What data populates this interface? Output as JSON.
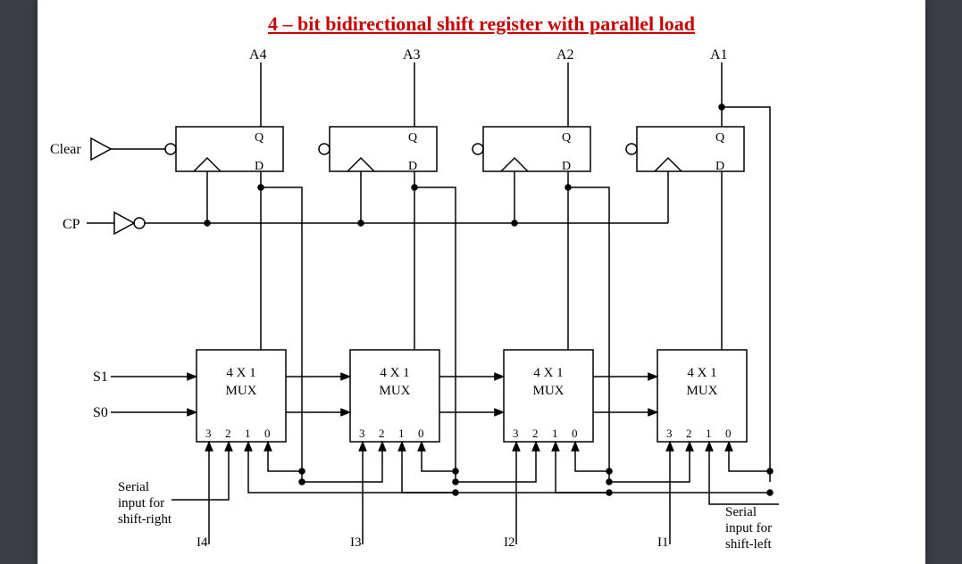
{
  "title": "4 – bit bidirectional shift register with parallel load",
  "outputs": {
    "A4": "A4",
    "A3": "A3",
    "A2": "A2",
    "A1": "A1"
  },
  "clear_label": "Clear",
  "cp_label": "CP",
  "ff": {
    "Q": "Q",
    "D": "D"
  },
  "mux": {
    "type": "4 X 1",
    "label": "MUX",
    "in3": "3",
    "in2": "2",
    "in1": "1",
    "in0": "0"
  },
  "select": {
    "S1": "S1",
    "S0": "S0"
  },
  "parallel_inputs": {
    "I4": "I4",
    "I3": "I3",
    "I2": "I2",
    "I1": "I1"
  },
  "serial_right_l1": "Serial",
  "serial_right_l2": "input for",
  "serial_right_l3": "shift-right",
  "serial_left_l1": "Serial",
  "serial_left_l2": "input for",
  "serial_left_l3": "shift-left"
}
